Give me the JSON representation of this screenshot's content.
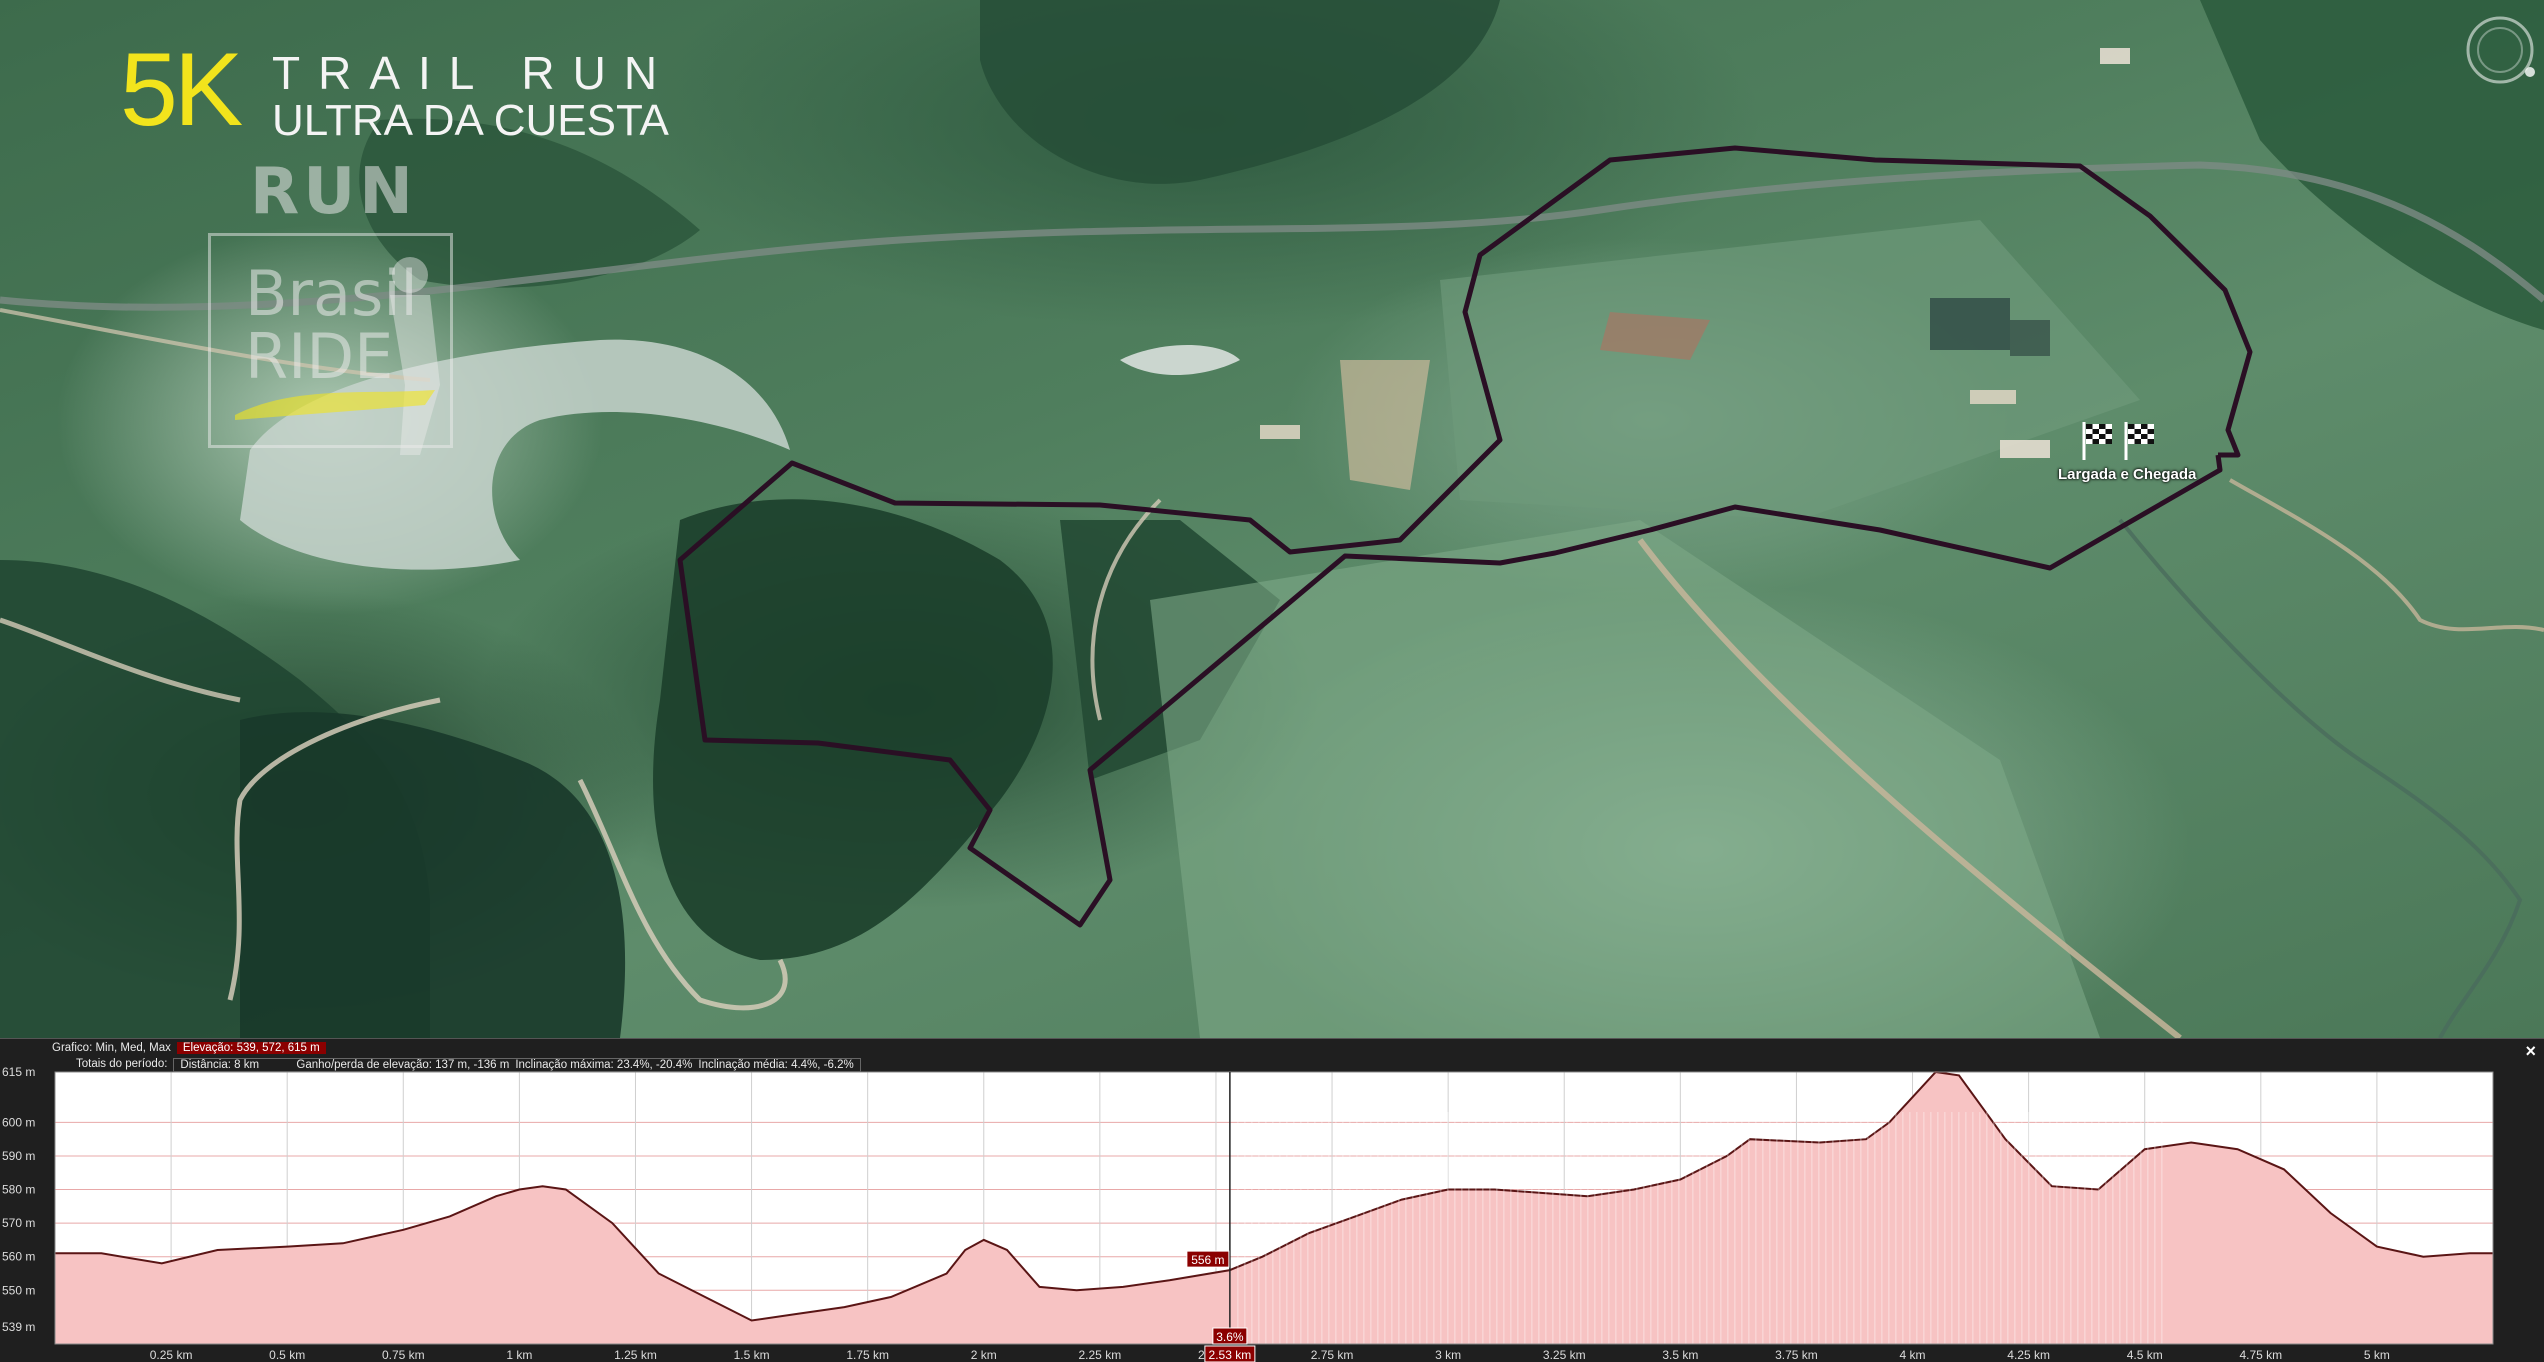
{
  "branding": {
    "distance": "5K",
    "line1": "TRAIL RUN",
    "line2": "ULTRA DA CUESTA",
    "logo_top": "RUN",
    "logo_word1": "Brasil",
    "logo_word2": "RIDE"
  },
  "map": {
    "finish_label": "Largada e Chegada",
    "route_color": "#2a0f24",
    "icons": [
      "checkered-flag-icon",
      "checkered-flag-icon",
      "compass-icon",
      "close-icon"
    ]
  },
  "elevation_panel": {
    "row1_label": "Grafico: Min, Med, Max",
    "row1_value": "Elevação: 539, 572, 615 m",
    "row2_label": "Totais do período:",
    "row2_distance": "Distância: 8 km",
    "row2_gain": "Ganho/perda de elevação: 137 m, -136 m",
    "row2_max_slope": "Inclinação máxima: 23.4%, -20.4%",
    "row2_avg_slope": "Inclinação média: 4.4%, -6.2%",
    "close_label": "×",
    "cursor_elevation": "556 m",
    "cursor_slope": "3.6%",
    "cursor_distance": "2.53 km",
    "highlight_color": "#8b0000"
  },
  "chart_data": {
    "type": "area",
    "xlabel": "",
    "ylabel": "",
    "xlim": [
      0,
      5.25
    ],
    "ylim": [
      534,
      615
    ],
    "y_ticks": [
      539,
      550,
      560,
      570,
      580,
      590,
      600,
      615
    ],
    "y_tick_labels": [
      "539 m",
      "550 m",
      "560 m",
      "570 m",
      "580 m",
      "590 m",
      "600 m",
      "615 m"
    ],
    "x_ticks": [
      0.25,
      0.5,
      0.75,
      1,
      1.25,
      1.5,
      1.75,
      2,
      2.25,
      2.5,
      2.75,
      3,
      3.25,
      3.5,
      3.75,
      4,
      4.25,
      4.5,
      4.75,
      5
    ],
    "x_tick_labels": [
      "0.25 km",
      "0.5 km",
      "0.75 km",
      "1 km",
      "1.25 km",
      "1.5 km",
      "1.75 km",
      "2 km",
      "2.25 km",
      "2.5 km",
      "2.75 km",
      "3 km",
      "3.25 km",
      "3.5 km",
      "3.75 km",
      "4 km",
      "4.25 km",
      "4.5 km",
      "4.75 km",
      "5 km"
    ],
    "grid": true,
    "series": [
      {
        "x": [
          0,
          0.1,
          0.23,
          0.35,
          0.5,
          0.62,
          0.75,
          0.85,
          0.95,
          1.0,
          1.05,
          1.1,
          1.2,
          1.3,
          1.4,
          1.5,
          1.6,
          1.7,
          1.8,
          1.92,
          1.96,
          2.0,
          2.05,
          2.12,
          2.2,
          2.3,
          2.4,
          2.53,
          2.6,
          2.7,
          2.8,
          2.9,
          3.0,
          3.1,
          3.2,
          3.3,
          3.4,
          3.5,
          3.6,
          3.65,
          3.8,
          3.9,
          3.95,
          4.05,
          4.1,
          4.2,
          4.3,
          4.4,
          4.5,
          4.6,
          4.7,
          4.8,
          4.9,
          5.0,
          5.1,
          5.2,
          5.25
        ],
        "y": [
          561,
          561,
          558,
          562,
          563,
          564,
          568,
          572,
          578,
          580,
          581,
          580,
          570,
          555,
          548,
          541,
          543,
          545,
          548,
          555,
          562,
          565,
          562,
          551,
          550,
          551,
          553,
          556,
          560,
          567,
          572,
          577,
          580,
          580,
          579,
          578,
          580,
          583,
          590,
          595,
          594,
          595,
          600,
          615,
          614,
          595,
          581,
          580,
          592,
          594,
          592,
          586,
          573,
          563,
          560,
          561,
          561
        ]
      }
    ],
    "cursor_x": 2.53
  }
}
